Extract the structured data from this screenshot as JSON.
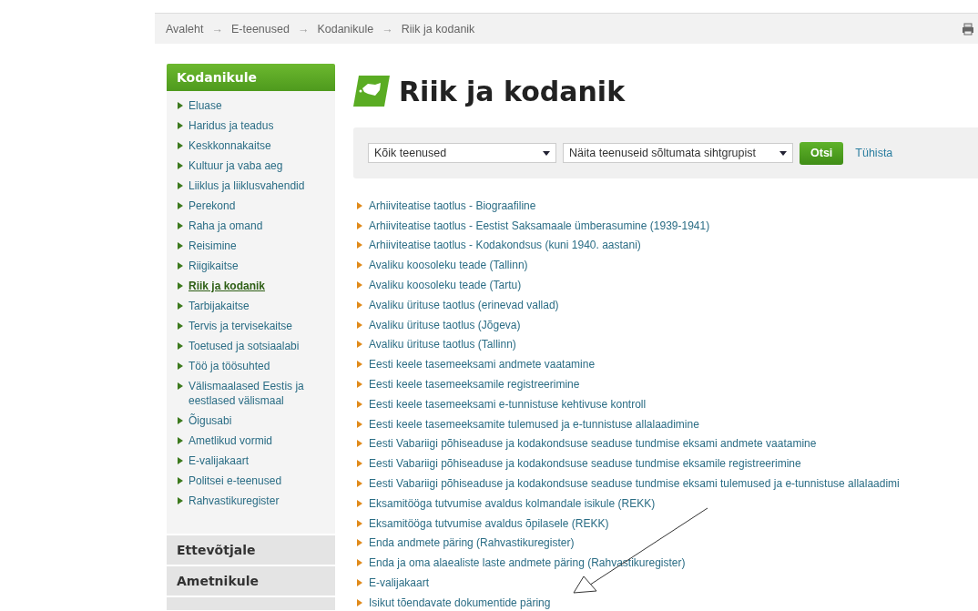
{
  "breadcrumb": [
    {
      "label": "Avaleht",
      "arrow": "→"
    },
    {
      "label": "E-teenused",
      "arrow": "→"
    },
    {
      "label": "Kodanikule",
      "arrow": "→"
    },
    {
      "label": "Riik ja kodanik"
    }
  ],
  "sidebar": {
    "title": "Kodanikule",
    "items": [
      {
        "label": "Eluase",
        "selected": false
      },
      {
        "label": "Haridus ja teadus",
        "selected": false
      },
      {
        "label": "Keskkonnakaitse",
        "selected": false
      },
      {
        "label": "Kultuur ja vaba aeg",
        "selected": false
      },
      {
        "label": "Liiklus ja liiklusvahendid",
        "selected": false
      },
      {
        "label": "Perekond",
        "selected": false
      },
      {
        "label": "Raha ja omand",
        "selected": false
      },
      {
        "label": "Reisimine",
        "selected": false
      },
      {
        "label": "Riigikaitse",
        "selected": false
      },
      {
        "label": "Riik ja kodanik",
        "selected": true
      },
      {
        "label": "Tarbijakaitse",
        "selected": false
      },
      {
        "label": "Tervis ja tervisekaitse",
        "selected": false
      },
      {
        "label": "Toetused ja sotsiaalabi",
        "selected": false
      },
      {
        "label": "Töö ja töösuhted",
        "selected": false
      },
      {
        "label": "Välismaalased Eestis ja eestlased välismaal",
        "selected": false
      },
      {
        "label": "Õigusabi",
        "selected": false
      },
      {
        "label": "Ametlikud vormid",
        "selected": false
      },
      {
        "label": "E-valijakaart",
        "selected": false
      },
      {
        "label": "Politsei e-teenused",
        "selected": false
      },
      {
        "label": "Rahvastikuregister",
        "selected": false
      }
    ],
    "sections": [
      "Ettevõtjale",
      "Ametnikule"
    ]
  },
  "title": "Riik ja kodanik",
  "filter": {
    "select_1": "Kõik teenused",
    "select_2": "Näita teenuseid sõltumata sihtgrupist",
    "search_button": "Otsi",
    "reset_link": "Tühista"
  },
  "services": [
    "Arhiiviteatise taotlus - Biograafiline",
    "Arhiiviteatise taotlus - Eestist Saksamaale ümberasumine (1939-1941)",
    "Arhiiviteatise taotlus - Kodakondsus (kuni 1940. aastani)",
    "Avaliku koosoleku teade (Tallinn)",
    "Avaliku koosoleku teade (Tartu)",
    "Avaliku ürituse taotlus (erinevad vallad)",
    "Avaliku ürituse taotlus (Jõgeva)",
    "Avaliku ürituse taotlus (Tallinn)",
    "Eesti keele tasemeeksami andmete vaatamine",
    "Eesti keele tasemeeksamile registreerimine",
    "Eesti keele tasemeeksami e-tunnistuse kehtivuse kontroll",
    "Eesti keele tasemeeksamite tulemused ja e-tunnistuse allalaadimine",
    "Eesti Vabariigi põhiseaduse ja kodakondsuse seaduse tundmise eksami andmete vaatamine",
    "Eesti Vabariigi põhiseaduse ja kodakondsuse seaduse tundmise eksamile registreerimine",
    "Eesti Vabariigi põhiseaduse ja kodakondsuse seaduse tundmise eksami tulemused ja e-tunnistuse allalaadimi",
    "Eksamitööga tutvumise avaldus kolmandale isikule (REKK)",
    "Eksamitööga tutvumise avaldus õpilasele (REKK)",
    "Enda andmete päring (Rahvastikuregister)",
    "Enda ja oma alaealiste laste andmete päring (Rahvastikuregister)",
    "E-valijakaart",
    "Isikut tõendavate dokumentide päring"
  ]
}
